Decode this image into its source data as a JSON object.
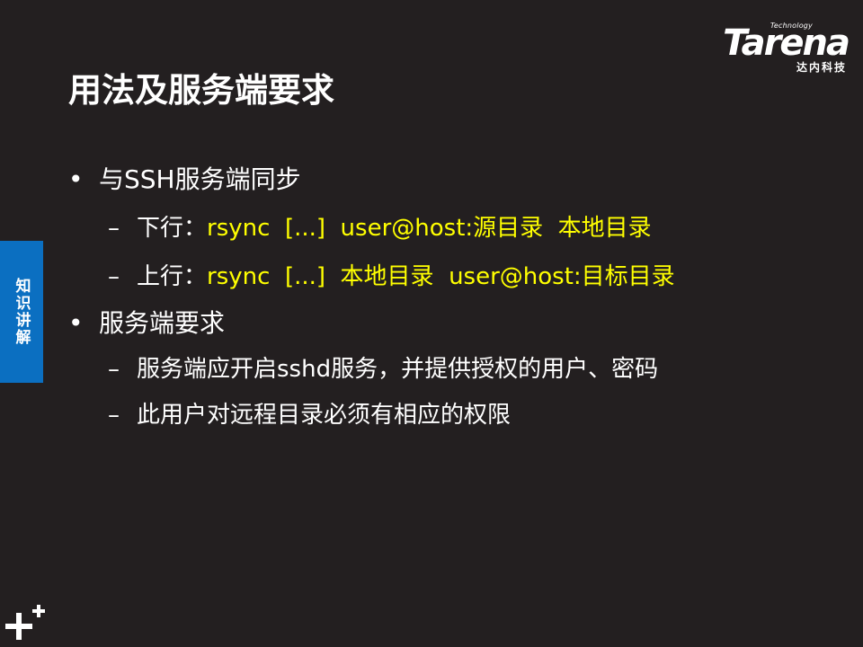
{
  "logo": {
    "superscript": "Technology",
    "wordmark": "Tarena",
    "chinese": "达内科技"
  },
  "title": "用法及服务端要求",
  "side_tab": "知识讲解",
  "content": {
    "item1": {
      "bullet": "•",
      "text": "与SSH服务端同步",
      "sub1": {
        "dash": "–",
        "prefix": "下行：",
        "cmd": "rsync  [...]  user@host:源目录  本地目录"
      },
      "sub2": {
        "dash": "–",
        "prefix": "上行：",
        "cmd": "rsync  [...]  本地目录  user@host:目标目录"
      }
    },
    "item2": {
      "bullet": "•",
      "text": "服务端要求",
      "sub1": {
        "dash": "–",
        "text": "服务端应开启sshd服务，并提供授权的用户、密码"
      },
      "sub2": {
        "dash": "–",
        "text": "此用户对远程目录必须有相应的权限"
      }
    }
  },
  "colors": {
    "background": "#231f20",
    "highlight": "#ffff00",
    "side_tab": "#0b6fc1"
  },
  "icons": {
    "corner": "plus-plus-icon"
  }
}
